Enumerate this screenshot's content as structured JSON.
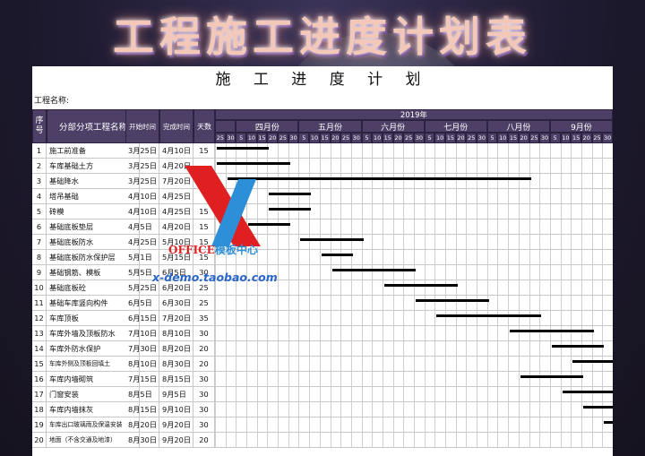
{
  "banner": {
    "title": "工程施工进度计划表"
  },
  "sheet": {
    "title": "施 工 进 度 计 划",
    "project_label": "工程名称:"
  },
  "headers": {
    "seq": "序号",
    "name": "分部分项工程名称",
    "start": "开始时间",
    "end": "完成时间",
    "days": "天数",
    "year": "2019年",
    "months": [
      "四月份",
      "五月份",
      "六月份",
      "七月份",
      "八月份",
      "9月份"
    ],
    "first_days": [
      "25",
      "30"
    ],
    "month_days": [
      "5",
      "10",
      "15",
      "20",
      "25",
      "30"
    ]
  },
  "rows": [
    {
      "no": "1",
      "name": "施工前准备",
      "start": "3月25日",
      "end": "4月10日",
      "days": "15"
    },
    {
      "no": "2",
      "name": "车库基础土方",
      "start": "3月25日",
      "end": "4月20日",
      "days": ""
    },
    {
      "no": "3",
      "name": "基础降水",
      "start": "3月25日",
      "end": "7月20日",
      "days": ""
    },
    {
      "no": "4",
      "name": "塔吊基础",
      "start": "4月10日",
      "end": "4月25日",
      "days": ""
    },
    {
      "no": "5",
      "name": "砖模",
      "start": "4月10日",
      "end": "4月25日",
      "days": "15"
    },
    {
      "no": "6",
      "name": "基础底板垫层",
      "start": "4月5日",
      "end": "4月20日",
      "days": "15"
    },
    {
      "no": "7",
      "name": "基础底板防水",
      "start": "4月25日",
      "end": "5月10日",
      "days": "15"
    },
    {
      "no": "8",
      "name": "基础底板防水保护层",
      "start": "5月1日",
      "end": "5月15日",
      "days": "15"
    },
    {
      "no": "9",
      "name": "基础钢筋、模板",
      "start": "5月5日",
      "end": "6月5日",
      "days": "30"
    },
    {
      "no": "10",
      "name": "基础底板砼",
      "start": "5月25日",
      "end": "6月20日",
      "days": "25"
    },
    {
      "no": "11",
      "name": "基础车库竖向构件",
      "start": "6月5日",
      "end": "6月30日",
      "days": "25"
    },
    {
      "no": "12",
      "name": "车库顶板",
      "start": "6月15日",
      "end": "7月20日",
      "days": "35"
    },
    {
      "no": "13",
      "name": "车库外墙及顶板防水",
      "start": "7月10日",
      "end": "8月10日",
      "days": "30"
    },
    {
      "no": "14",
      "name": "车库外防水保护",
      "start": "7月30日",
      "end": "8月20日",
      "days": "20"
    },
    {
      "no": "15",
      "name": "车库外侧及顶板回填土",
      "start": "8月10日",
      "end": "8月30日",
      "days": "20"
    },
    {
      "no": "16",
      "name": "车库内墙砌筑",
      "start": "7月15日",
      "end": "8月15日",
      "days": "30"
    },
    {
      "no": "17",
      "name": "门窗安装",
      "start": "8月5日",
      "end": "9月5日",
      "days": "30"
    },
    {
      "no": "18",
      "name": "车库内墙抹灰",
      "start": "8月15日",
      "end": "9月10日",
      "days": "30"
    },
    {
      "no": "19",
      "name": "车库出口玻璃雨及保温安装",
      "start": "8月20日",
      "end": "9月20日",
      "days": "30"
    },
    {
      "no": "20",
      "name": "地面（不含交通及地漆）",
      "start": "8月30日",
      "end": "9月20日",
      "days": "20"
    }
  ],
  "gantt": [
    {
      "from": 0,
      "to": 5
    },
    {
      "from": 0,
      "to": 7
    },
    {
      "from": 1,
      "to": 30
    },
    {
      "from": 5,
      "to": 9
    },
    {
      "from": 5,
      "to": 9
    },
    {
      "from": 3,
      "to": 7
    },
    {
      "from": 8,
      "to": 14
    },
    {
      "from": 10,
      "to": 13
    },
    {
      "from": 11,
      "to": 19
    },
    {
      "from": 16,
      "to": 23
    },
    {
      "from": 19,
      "to": 26
    },
    {
      "from": 21,
      "to": 31
    },
    {
      "from": 28,
      "to": 36
    },
    {
      "from": 32,
      "to": 37
    },
    {
      "from": 34,
      "to": 40
    },
    {
      "from": 29,
      "to": 35
    },
    {
      "from": 33,
      "to": 41
    },
    {
      "from": 35,
      "to": 42
    },
    {
      "from": 37,
      "to": 45
    },
    {
      "from": 40,
      "to": 46
    }
  ],
  "watermark": {
    "office": "OFFICE",
    "office_cn": "模板中心",
    "url": "x-demo.taobao.com"
  }
}
